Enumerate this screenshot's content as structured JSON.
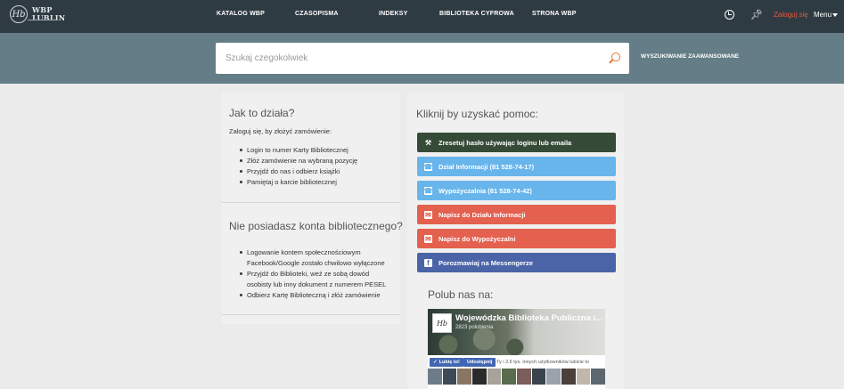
{
  "brand": {
    "logo_line1": "WBP",
    "logo_line2": "LUBLIN",
    "logo_mark": "Hb"
  },
  "nav": {
    "items": [
      {
        "label": "KATALOG WBP"
      },
      {
        "label": "CZASOPISMA"
      },
      {
        "label": "INDEKSY"
      },
      {
        "label": "BIBLIOTEKA CYFROWA"
      },
      {
        "label": "STRONA WBP"
      }
    ],
    "history_icon": "history-icon",
    "pin_icon": "pin-icon",
    "login_label": "Zaloguj się",
    "menu_label": "Menu"
  },
  "search": {
    "placeholder": "Szukaj czegokolwiek",
    "advanced_label": "WYSZUKIWANIE ZAAWANSOWANE"
  },
  "how_it_works": {
    "title": "Jak to działa?",
    "intro": "Zaloguj się, by złożyć zamówienie:",
    "steps": [
      "Login to numer Karty Bibliotecznej",
      "Złóż zamówienie na wybraną pozycję",
      "Przyjdź do nas i odbierz książki",
      "Pamiętaj o karcie bibliotecznej"
    ]
  },
  "no_account": {
    "title": "Nie posiadasz konta bibliotecznego?",
    "steps": [
      [
        "Logowanie kontem społecznościowym",
        "Facebook/Google zostało chwilowo wyłączone"
      ],
      [
        "Przyjdź do Biblioteki, weź ze sobą dowód",
        "osobisty lub inny dokument z numerem PESEL"
      ],
      [
        "Odbierz Kartę Biblioteczną i złóż zamówienie"
      ]
    ]
  },
  "help": {
    "title": "Kliknij by uzyskać pomoc:",
    "buttons": [
      {
        "label": "Zresetuj hasło używając loginu lub emaila",
        "icon": "key-icon",
        "color": "#354a37"
      },
      {
        "label": "Dział Informacji (81 528-74-17)",
        "icon": "phone-icon",
        "color": "#68b5ec"
      },
      {
        "label": "Wypożyczalnia (81 528-74-42)",
        "icon": "phone-icon",
        "color": "#68b5ec"
      },
      {
        "label": "Napisz do Działu Informacji",
        "icon": "envelope-icon",
        "color": "#e4604f"
      },
      {
        "label": "Napisz do Wypożyczalni",
        "icon": "envelope-icon",
        "color": "#e4604f"
      },
      {
        "label": "Porozmawiaj na Messengerze",
        "icon": "facebook-icon",
        "color": "#4b64a8"
      }
    ]
  },
  "follow": {
    "title": "Polub nas na:",
    "page_name": "Wojewódzka Biblioteka Publiczna i...",
    "likes": "2823 polubienia",
    "like_label": "Lubię to!",
    "share_label": "Udostępnij",
    "friends_text": "Ty i 2,6 tys. innych użytkowników lubicie to"
  },
  "colors": {
    "topbar": "#2f3b43",
    "search_band": "#647d87",
    "login_link": "#e8573f",
    "search_icon": "#e8742c"
  }
}
